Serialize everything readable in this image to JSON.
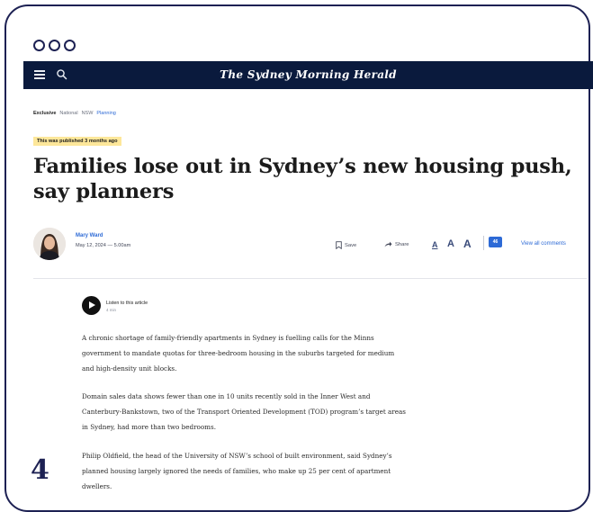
{
  "nav": {
    "masthead": "The Sydney Morning Herald"
  },
  "breadcrumb": [
    "Exclusive",
    "National",
    "NSW",
    "Planning"
  ],
  "article": {
    "badge": "This was published 3 months ago",
    "headline": "Families lose out in Sydney’s new housing push, say planners",
    "author_name": "Mary Ward",
    "date": "May 12, 2024 — 5.00am",
    "actions": {
      "save": "Save",
      "share": "Share"
    },
    "text_size": {
      "small": "A",
      "medium": "A",
      "large": "A"
    },
    "comments": {
      "count": "46",
      "link": "View all comments"
    },
    "listen": {
      "label": "Listen to this article",
      "duration": "4 min"
    },
    "paragraphs": [
      "A chronic shortage of family-friendly apartments in Sydney is fuelling calls for the Minns government to mandate quotas for three-bedroom housing in the suburbs targeted for medium and high-density unit blocks.",
      "Domain sales data shows fewer than one in 10 units recently sold in the Inner West and Canterbury-Bankstown, two of the Transport Oriented Development (TOD) program’s target areas in Sydney, had more than two bedrooms.",
      "Philip Oldfield, the head of the University of NSW’s school of built environment, said Sydney’s planned housing largely ignored the needs of families, who make up 25 per cent of apartment dwellers."
    ]
  },
  "slide": {
    "number": "4"
  },
  "colors": {
    "frame": "#1d2153",
    "navbar": "#0a1a3d",
    "badge": "#fde79a",
    "link": "#2d6ad6"
  },
  "icons": [
    "menu-icon",
    "search-icon",
    "bookmark-icon",
    "share-arrow-icon",
    "comment-icon",
    "play-icon"
  ]
}
